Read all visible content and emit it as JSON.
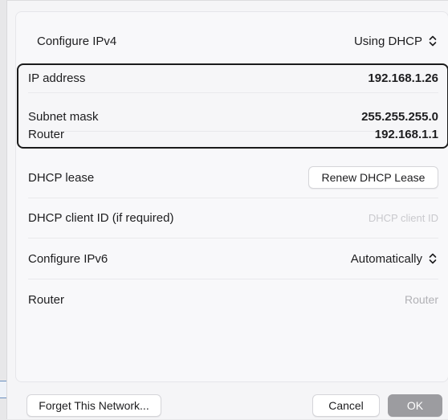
{
  "ipv4": {
    "configure_label": "Configure IPv4",
    "configure_value": "Using DHCP"
  },
  "network": {
    "ip_label": "IP address",
    "ip_value": "192.168.1.26",
    "subnet_label": "Subnet mask",
    "subnet_value": "255.255.255.0",
    "router_label": "Router",
    "router_value": "192.168.1.1"
  },
  "dhcp": {
    "lease_label": "DHCP lease",
    "renew_button": "Renew DHCP Lease",
    "client_id_label": "DHCP client ID (if required)",
    "client_id_placeholder": "DHCP client ID"
  },
  "ipv6": {
    "configure_label": "Configure IPv6",
    "configure_value": "Automatically",
    "router_label": "Router",
    "router_placeholder": "Router"
  },
  "footer": {
    "forget_button": "Forget This Network...",
    "cancel_button": "Cancel",
    "ok_button": "OK"
  },
  "icons": {
    "select_chevrons": "up-down-chevron-icon"
  },
  "colors": {
    "highlight_border": "#1b1b1b",
    "ok_button_bg": "#9c9ca0"
  }
}
